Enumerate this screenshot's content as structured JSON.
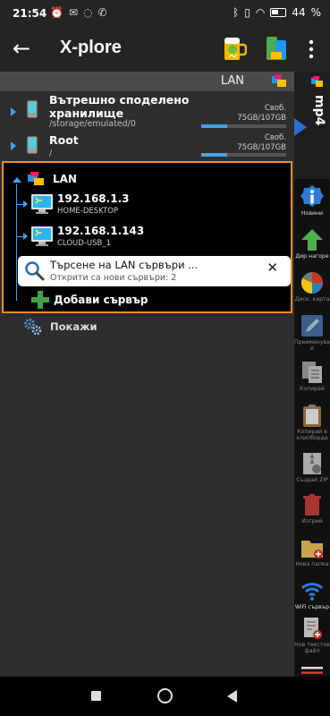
{
  "status_bar": {
    "time": "21:54",
    "battery": "44"
  },
  "app_bar": {
    "title": "X-plore"
  },
  "panel": {
    "header_title": "LAN",
    "devices": [
      {
        "title": "Вътрешно споделено хранилище",
        "path": "/storage/emulated/0",
        "free_label": "Своб.",
        "free_value": "75GB/107GB",
        "used_fraction": 0.3
      },
      {
        "title": "Root",
        "path": "/",
        "free_label": "Своб.",
        "free_value": "75GB/107GB",
        "used_fraction": 0.3
      }
    ],
    "lan": {
      "label": "LAN",
      "servers": [
        {
          "ip": "192.168.1.3",
          "name": "HOME-DESKTOP"
        },
        {
          "ip": "192.168.1.143",
          "name": "CLOUD-USB_1"
        }
      ],
      "search": {
        "title": "Търсене на LAN сървъри ...",
        "subtitle": "Открити са нови сървъри: 2"
      },
      "add_server": "Добави сървър"
    },
    "show": "Покажи"
  },
  "second_pane": {
    "label": "mp4"
  },
  "toolbar": {
    "items": [
      {
        "label": "Новини",
        "icon": "info-icon",
        "dim": false
      },
      {
        "label": "Дир нагоре",
        "icon": "up-arrow-icon",
        "dim": false
      },
      {
        "label": "Диск. карта",
        "icon": "disk-map-icon",
        "dim": true
      },
      {
        "label": "Преименува й",
        "icon": "rename-icon",
        "dim": true
      },
      {
        "label": "Копирай",
        "icon": "copy-icon",
        "dim": true
      },
      {
        "label": "Копирай в клипборда",
        "icon": "clipboard-icon",
        "dim": true
      },
      {
        "label": "Създай ZIP",
        "icon": "zip-icon",
        "dim": true
      },
      {
        "label": "Изтрий",
        "icon": "trash-icon",
        "dim": true
      },
      {
        "label": "Нова папка",
        "icon": "new-folder-icon",
        "dim": true
      },
      {
        "label": "WiFi сървър",
        "icon": "wifi-icon",
        "dim": false
      },
      {
        "label": "Нов текстов файл",
        "icon": "new-text-file-icon",
        "dim": true
      }
    ]
  }
}
